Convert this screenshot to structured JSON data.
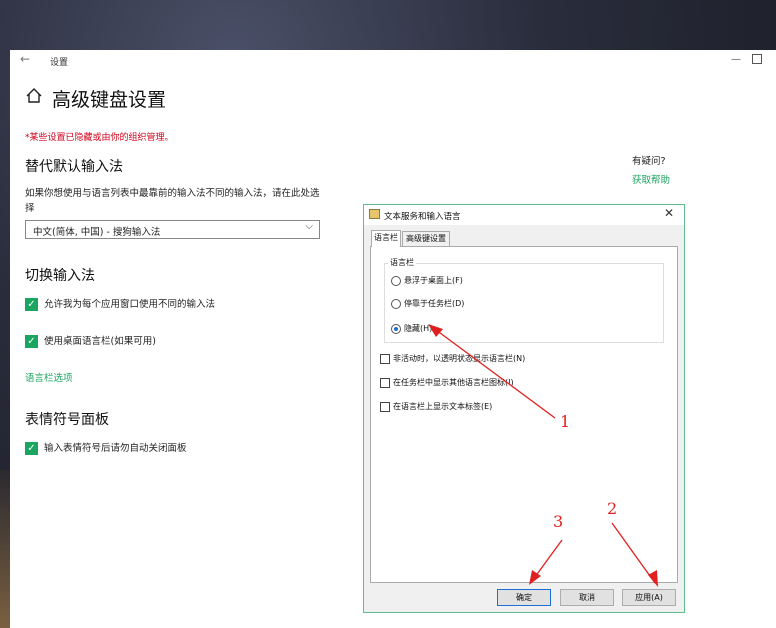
{
  "window": {
    "app_title": "设置",
    "back_icon": "back-arrow-icon",
    "minimize_label": "—"
  },
  "page": {
    "title": "高级键盘设置",
    "warning": "*某些设置已隐藏或由你的组织管理。"
  },
  "override_section": {
    "heading": "替代默认输入法",
    "description": "如果你想使用与语言列表中最靠前的输入法不同的输入法，请在此处选择",
    "dropdown_value": "中文(简体, 中国) - 搜狗输入法"
  },
  "switch_section": {
    "heading": "切换输入法",
    "checkbox1": "允许我为每个应用窗口使用不同的输入法",
    "checkbox2": "使用桌面语言栏(如果可用)",
    "link": "语言栏选项"
  },
  "emoji_section": {
    "heading": "表情符号面板",
    "checkbox1": "输入表情符号后请勿自动关闭面板"
  },
  "help": {
    "question": "有疑问?",
    "link": "获取帮助"
  },
  "dialog": {
    "title": "文本服务和输入语言",
    "tabs": [
      "语言栏",
      "高级键设置"
    ],
    "group_title": "语言栏",
    "radios": [
      "悬浮于桌面上(F)",
      "停靠于任务栏(D)",
      "隐藏(H)"
    ],
    "selected_radio": "隐藏(H)",
    "checkboxes": [
      "非活动时，以透明状态显示语言栏(N)",
      "在任务栏中显示其他语言栏图标(I)",
      "在语言栏上显示文本标签(E)"
    ],
    "buttons": {
      "ok": "确定",
      "cancel": "取消",
      "apply": "应用(A)"
    },
    "close_glyph": "✕"
  },
  "annotations": {
    "n1": "1",
    "n2": "2",
    "n3": "3",
    "color": "#e02020"
  },
  "colors": {
    "accent": "#1aa560",
    "warning": "#d0021b",
    "dialog_border": "#5fbf8a"
  }
}
